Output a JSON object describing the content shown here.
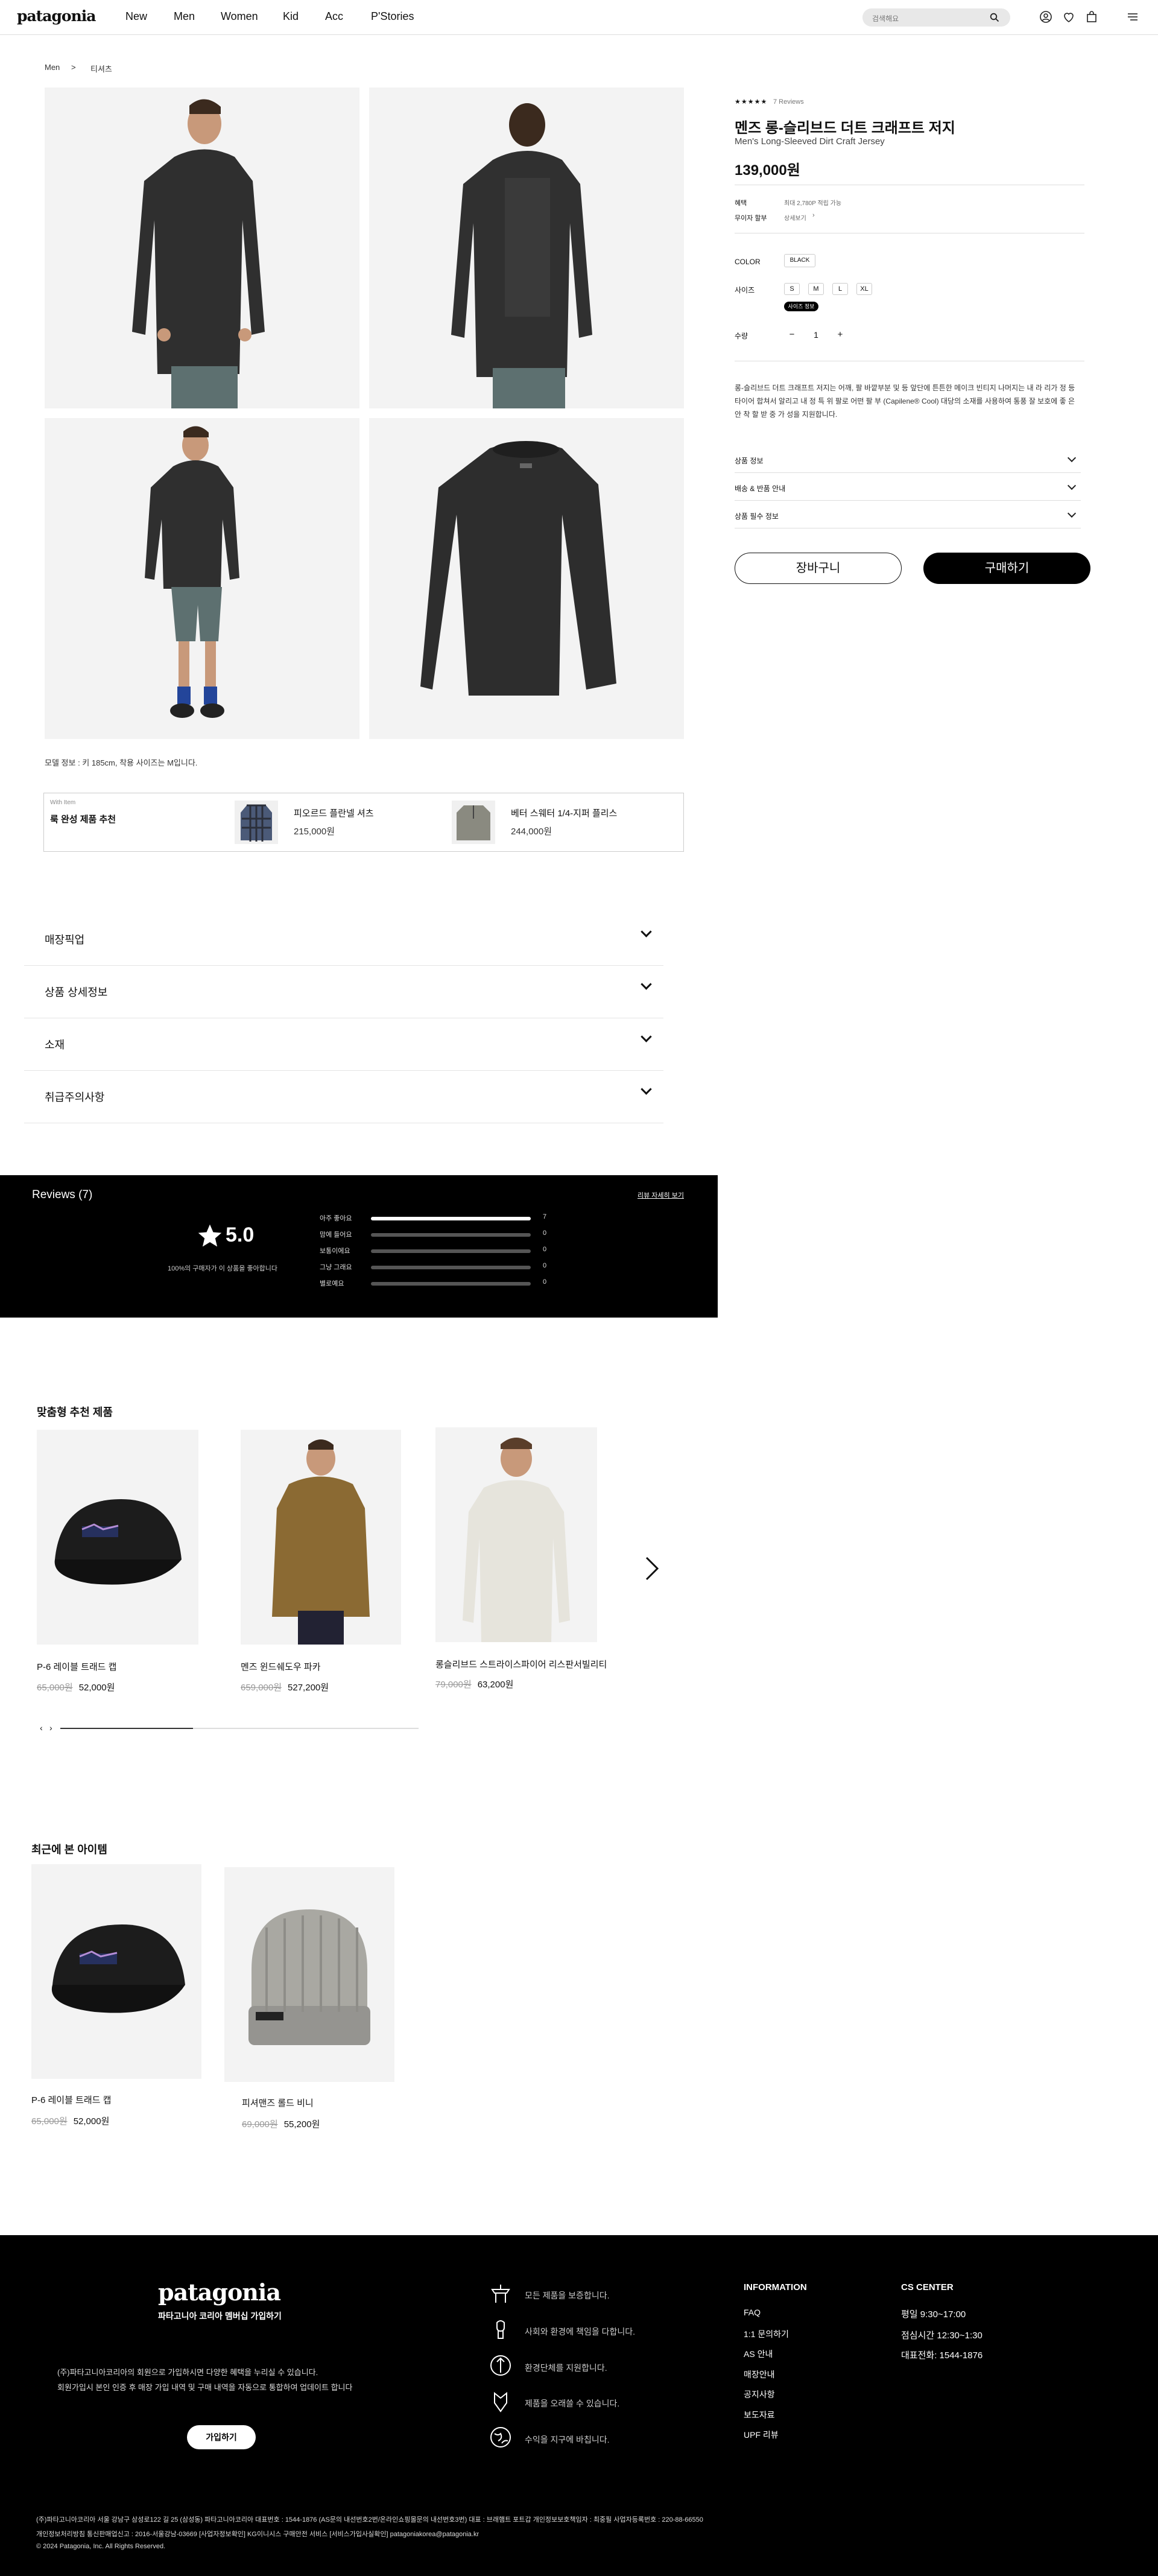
{
  "header": {
    "logo": "patagonia",
    "nav": [
      "New",
      "Men",
      "Women",
      "Kid",
      "Acc",
      "P'Stories"
    ],
    "search_placeholder": "검색해요"
  },
  "breadcrumb": [
    "Men",
    "티셔츠"
  ],
  "product": {
    "stars": "★★★★★",
    "review_count": "7 Reviews",
    "title_ko": "멘즈 롱-슬리브드 더트 크래프트 저지",
    "title_en": "Men's Long-Sleeved Dirt Craft Jersey",
    "price": "139,000원",
    "benefit_label": "혜택",
    "benefit_value": "최대 2,780P 적립 가능",
    "installment_label": "무이자 할부",
    "installment_value": "상세보기",
    "color_label": "COLOR",
    "color_value": "BLACK",
    "size_label": "사이즈",
    "sizes": [
      "S",
      "M",
      "L",
      "XL"
    ],
    "size_tooltip": "사이즈 정보",
    "qty_label": "수량",
    "qty_minus": "−",
    "qty_value": "1",
    "qty_plus": "+",
    "description": "롱-슬리브드 더트 크래프트 저지는 어깨, 팔 바깥부분 및 등 앞단에 튼튼한 메이크 빈티지 나머지는 내 라 리가 정 등 타이어 합쳐서 알리고 내 정 특 위 팔로 어떤 팔 부 (Capilene® Cool) 대당의 소재를 사용하여 통풍 잘 보호에 좋 은 안 착 할 받 중 가 성을 지원합니다.",
    "accordion": [
      "상품 정보",
      "배송 & 반품 안내",
      "상품 필수 정보"
    ],
    "cart_label": "장바구니",
    "buy_label": "구매하기",
    "model_note": "모델 정보 : 키 185cm, 착용 사이즈는 M입니다."
  },
  "with_item": {
    "label": "With Item",
    "title": "룩 완성 제품 추천",
    "items": [
      {
        "name": "피오르드 플란넬 셔츠",
        "price": "215,000원"
      },
      {
        "name": "베터 스웨터 1/4-지퍼 플리스",
        "price": "244,000원"
      }
    ]
  },
  "sections": [
    "매장픽업",
    "상품 상세정보",
    "소재",
    "취급주의사항"
  ],
  "reviews": {
    "title": "Reviews (7)",
    "link": "리뷰 자세히 보기",
    "score": "5.0",
    "recommend": "100%의 구매자가 이 상품을 좋아합니다",
    "rows": [
      {
        "label": "아주 좋아요",
        "count": "7",
        "fill": 1.0
      },
      {
        "label": "맘에 들어요",
        "count": "0",
        "fill": 0
      },
      {
        "label": "보통이에요",
        "count": "0",
        "fill": 0
      },
      {
        "label": "그냥 그래요",
        "count": "0",
        "fill": 0
      },
      {
        "label": "별로예요",
        "count": "0",
        "fill": 0
      }
    ]
  },
  "recommend": {
    "title": "맞춤형 추천 제품",
    "items": [
      {
        "name": "P-6 레이블 트래드 캡",
        "old": "65,000원",
        "price": "52,000원"
      },
      {
        "name": "멘즈 윈드쉐도우 파카",
        "old": "659,000원",
        "price": "527,200원"
      },
      {
        "name": "롱슬리브드 스트라이스파이어 리스판서빌리티",
        "old": "79,000원",
        "price": "63,200원"
      }
    ]
  },
  "recent": {
    "title": "최근에 본 아이템",
    "items": [
      {
        "name": "P-6 레이블 트래드 캡",
        "old": "65,000원",
        "price": "52,000원"
      },
      {
        "name": "피셔맨즈 롤드 비니",
        "old": "69,000원",
        "price": "55,200원"
      }
    ]
  },
  "footer": {
    "logo": "patagonia",
    "member_title": "파타고니아 코리아 멤버십 가입하기",
    "member_text1": "(주)파타고니아코리아의 회원으로 가입하시면 다양한 혜택을 누리실 수 있습니다.",
    "member_text2": "회원가입시 본인 인증 후 매장 가입 내역 및 구매 내역을 자동으로 통합하여 업데이트 합니다",
    "join": "가입하기",
    "values": [
      "모든 제품을 보증합니다.",
      "사회와 환경에 책임을 다합니다.",
      "환경단체를 지원합니다.",
      "제품을 오래쓸 수 있습니다.",
      "수익을 지구에 바칩니다."
    ],
    "info_title": "INFORMATION",
    "info_links": [
      "FAQ",
      "1:1 문의하기",
      "AS 안내",
      "매장안내",
      "공지사항",
      "보도자료",
      "UPF 리뷰"
    ],
    "cs_title": "CS CENTER",
    "cs_lines": [
      "평일 9:30~17:00",
      "점심시간 12:30~1:30",
      "대표전화: 1544-1876"
    ],
    "legal1": "(주)파타고니아코리아 서울 강남구 삼성로122 길 25 (삼성동) 파타고니아코리아 대표번호 : 1544-1876 (AS문의 내선번호2번/온라인쇼핑몰문의 내선번호3번) 대표 : 브래햄트 포트갑 개인정보보호책임자 : 최중필 사업자등록번호 : 220-88-66550",
    "legal2": "개인정보처리방침 통신판매업신고 : 2016-서울강남-03669 [사업자정보확인] KG이니시스 구매안전 서비스 [서비스가입사실확인] patagoniakorea@patagonia.kr",
    "copyright": "© 2024 Patagonia, Inc. All Rights Reserved."
  }
}
